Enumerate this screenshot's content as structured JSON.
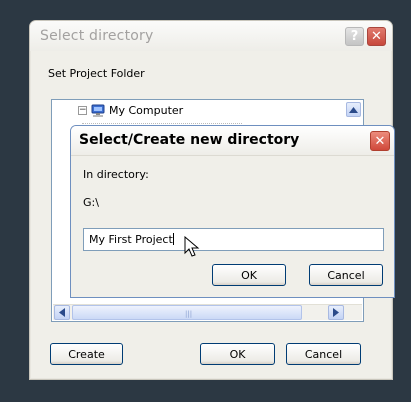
{
  "outer_dialog": {
    "title": "Select directory",
    "help_label": "?",
    "close_label": "✕",
    "folder_label": "Set Project Folder",
    "tree": {
      "root_label": "My Computer",
      "root_expander": "−",
      "icon": "computer-icon"
    },
    "scroll_up": "▲",
    "scroll_left": "◀",
    "scroll_right": "▶",
    "thumb_grip": "|||",
    "buttons": {
      "create": "Create",
      "ok": "OK",
      "cancel": "Cancel"
    }
  },
  "inner_dialog": {
    "title": "Select/Create new directory",
    "close_label": "✕",
    "in_directory_label": "In directory:",
    "path": "G:\\",
    "input_value": "My First Project",
    "buttons": {
      "ok": "OK",
      "cancel": "Cancel"
    }
  },
  "colors": {
    "desktop": "#2c3843",
    "dialog_bg": "#f0efe9",
    "close_red": "#d0483a",
    "input_border": "#7f9db9"
  }
}
